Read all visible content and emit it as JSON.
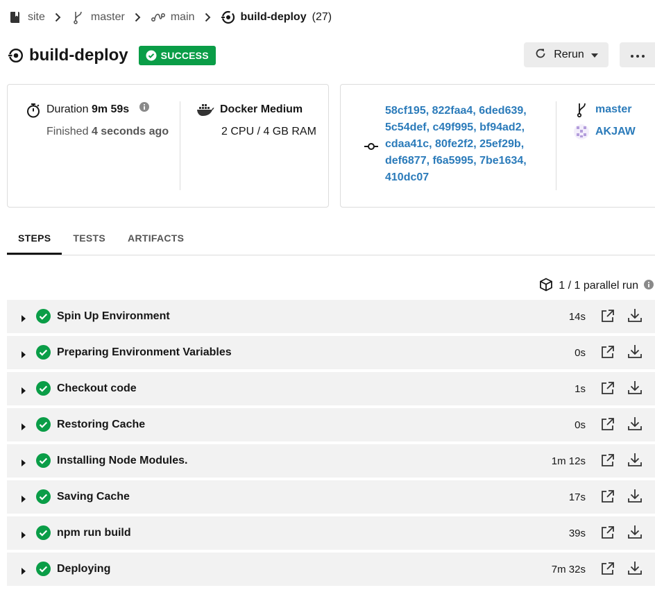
{
  "breadcrumb": {
    "project": "site",
    "branch": "master",
    "workflow": "main",
    "job": "build-deploy",
    "job_number": "(27)"
  },
  "job": {
    "title": "build-deploy",
    "status": "SUCCESS",
    "rerun_label": "Rerun"
  },
  "summary": {
    "duration_label": "Duration",
    "duration_value": "9m 59s",
    "finished_label": "Finished",
    "finished_value": "4 seconds ago",
    "executor_name": "Docker Medium",
    "executor_spec": "2 CPU / 4 GB RAM",
    "commits": "58cf195, 822faa4, 6ded639, 5c54def, c49f995, bf94ad2, cdaa41c, 80fe2f2, 25ef29b, def6877, f6a5995, 7be1634, 410dc07",
    "branch": "master",
    "user": "AKJAW"
  },
  "tabs": [
    {
      "label": "STEPS",
      "active": true
    },
    {
      "label": "TESTS",
      "active": false
    },
    {
      "label": "ARTIFACTS",
      "active": false
    }
  ],
  "parallel_label": "1 / 1 parallel run",
  "steps": [
    {
      "name": "Spin Up Environment",
      "duration": "14s"
    },
    {
      "name": "Preparing Environment Variables",
      "duration": "0s"
    },
    {
      "name": "Checkout code",
      "duration": "1s"
    },
    {
      "name": "Restoring Cache",
      "duration": "0s"
    },
    {
      "name": "Installing Node Modules.",
      "duration": "1m 12s"
    },
    {
      "name": "Saving Cache",
      "duration": "17s"
    },
    {
      "name": "npm run build",
      "duration": "39s"
    },
    {
      "name": "Deploying",
      "duration": "7m 32s"
    }
  ],
  "colors": {
    "success": "#0a9d47",
    "link": "#2b7bba",
    "row_bg": "#f2f2f2"
  }
}
